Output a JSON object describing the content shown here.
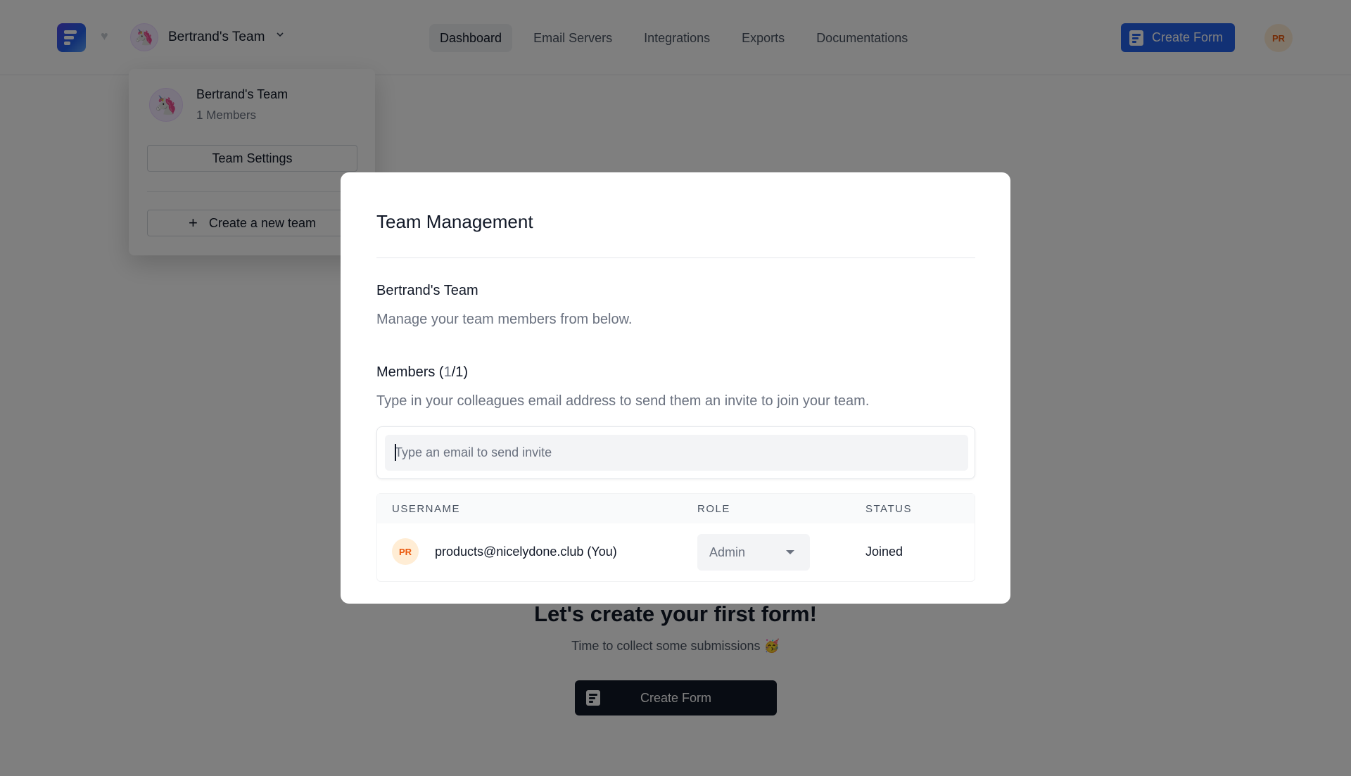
{
  "header": {
    "team_name": "Bertrand's Team",
    "nav": [
      "Dashboard",
      "Email Servers",
      "Integrations",
      "Exports",
      "Documentations"
    ],
    "active_nav": "Dashboard",
    "create_form_label": "Create Form",
    "user_initials": "PR",
    "accent_color": "#2563eb"
  },
  "team_dropdown": {
    "team_name": "Bertrand's Team",
    "members_label": "1 Members",
    "settings_label": "Team Settings",
    "new_team_label": "Create a new team"
  },
  "page": {
    "empty_title": "Let's create your first form!",
    "empty_subtitle": "Time to collect some submissions 🥳",
    "create_form_label": "Create Form"
  },
  "modal": {
    "title": "Team Management",
    "team_name": "Bertrand's Team",
    "team_description": "Manage your team members from below.",
    "members_prefix": "Members (",
    "members_count": "1",
    "members_suffix": "/1)",
    "members_description": "Type in your colleagues email address to send them an invite to join your team.",
    "invite_placeholder": "Type an email to send invite",
    "columns": [
      "USERNAME",
      "ROLE",
      "STATUS"
    ],
    "rows": [
      {
        "initials": "PR",
        "username": "products@nicelydone.club (You)",
        "role": "Admin",
        "status": "Joined"
      }
    ]
  }
}
